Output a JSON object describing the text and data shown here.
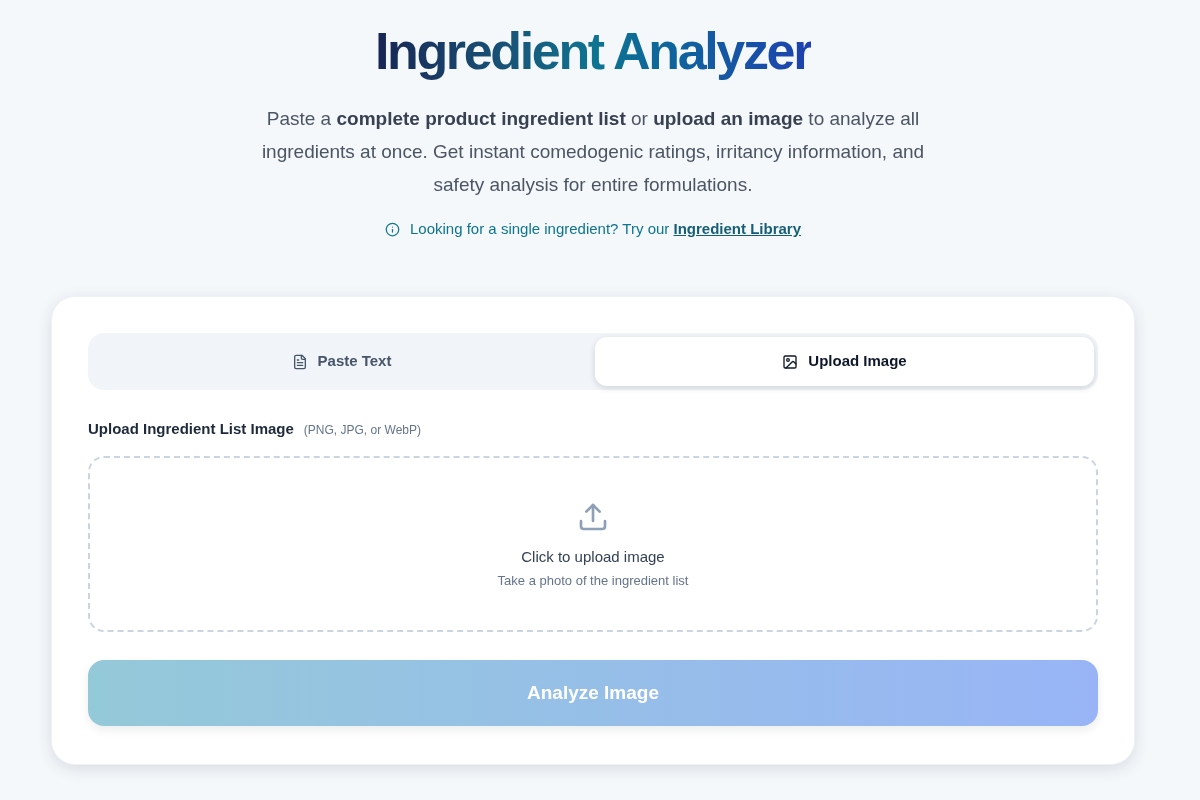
{
  "header": {
    "title": "Ingredient Analyzer",
    "description": "Paste a **complete product ingredient list** or **upload an image** to analyze all ingredients at once. Get instant comedogenic ratings, irritancy information, and safety analysis for entire formulations.",
    "hint": {
      "text": "Looking for a single ingredient? Try our",
      "link": "Ingredient Library"
    }
  },
  "tabs": [
    {
      "label": "Paste Text",
      "kind": "text",
      "selected": false
    },
    {
      "label": "Upload Image",
      "kind": "image",
      "selected": true
    }
  ],
  "upload": {
    "label": "Upload Ingredient List Image",
    "formats": "(PNG, JPG, or WebP)",
    "prompt": "Click to upload image",
    "subtext": "Take a photo of the ingredient list"
  },
  "submit": {
    "label": "Analyze Image",
    "disabled": true
  }
}
